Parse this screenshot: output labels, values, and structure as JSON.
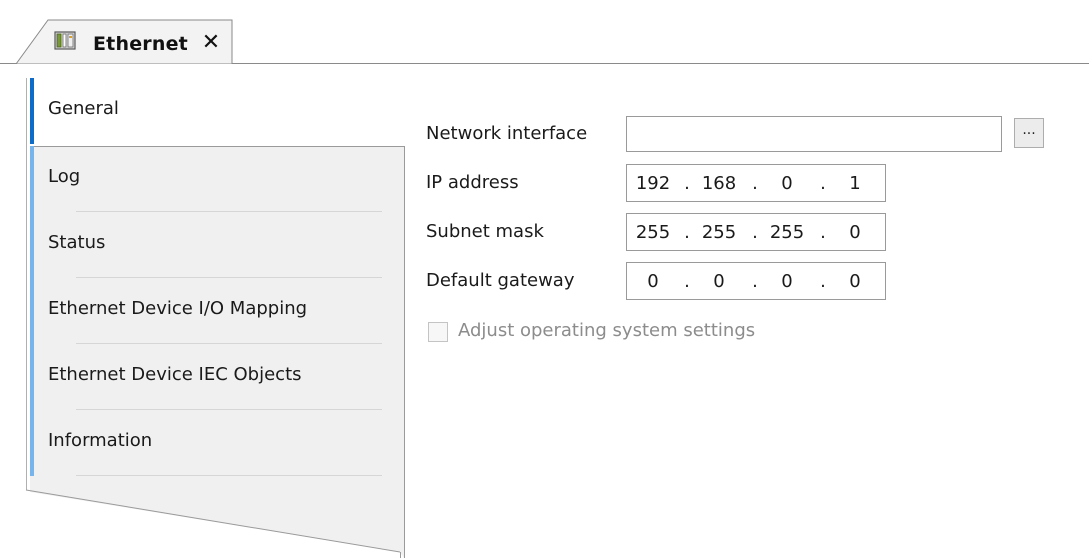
{
  "editor_tab": {
    "title": "Ethernet",
    "icon": "device-icon",
    "close_glyph": "✕"
  },
  "nav": {
    "items": [
      {
        "label": "General",
        "active": true
      },
      {
        "label": "Log",
        "active": false
      },
      {
        "label": "Status",
        "active": false
      },
      {
        "label": "Ethernet Device I/O Mapping",
        "active": false
      },
      {
        "label": "Ethernet Device IEC Objects",
        "active": false
      },
      {
        "label": "Information",
        "active": false
      }
    ]
  },
  "general": {
    "network_interface": {
      "label": "Network interface",
      "value": "",
      "browse_label": "..."
    },
    "ip_address": {
      "label": "IP address",
      "octets": [
        "192",
        "168",
        "0",
        "1"
      ]
    },
    "subnet_mask": {
      "label": "Subnet mask",
      "octets": [
        "255",
        "255",
        "255",
        "0"
      ]
    },
    "default_gateway": {
      "label": "Default gateway",
      "octets": [
        "0",
        "0",
        "0",
        "0"
      ]
    },
    "adjust_os": {
      "label": "Adjust operating system settings",
      "checked": false,
      "enabled": false
    }
  },
  "colors": {
    "active_marker": "#0e6bc8",
    "inactive_marker": "#78b4ec",
    "nav_background": "#f0f0f0",
    "disabled_text": "#8c8c8c"
  }
}
